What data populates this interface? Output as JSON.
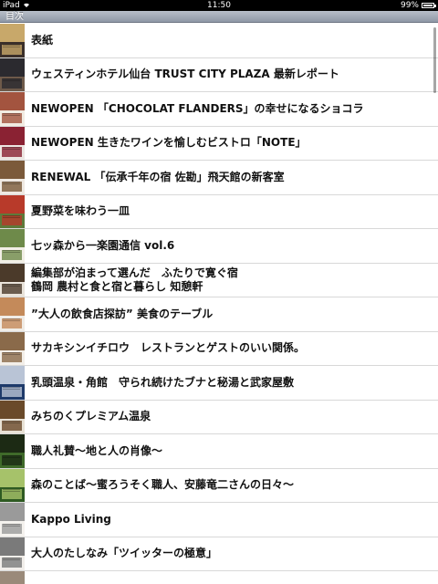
{
  "status": {
    "device": "iPad",
    "time": "11:50",
    "battery": "99%",
    "battery_level": 0.99
  },
  "header": {
    "title": "目次"
  },
  "items": [
    {
      "label": "表紙",
      "thumb": [
        "#3a2f2a",
        "#c8a86a"
      ]
    },
    {
      "label": "ウェスティンホテル仙台 TRUST CITY PLAZA 最新レポート",
      "thumb": [
        "#6e5a4a",
        "#2b2a2f"
      ]
    },
    {
      "label": "NEWOPEN 「CHOCOLAT FLANDERS」の幸せになるショコラ",
      "thumb": [
        "#f1ebe2",
        "#a3543f"
      ]
    },
    {
      "label": "NEWOPEN 生きたワインを愉しむビストロ「NOTE」",
      "thumb": [
        "#ece6e2",
        "#8a2233"
      ]
    },
    {
      "label": "RENEWAL 「伝承千年の宿 佐勘」飛天館の新客室",
      "thumb": [
        "#efe9e2",
        "#7b5a3a"
      ]
    },
    {
      "label": "夏野菜を味わう一皿",
      "thumb": [
        "#5d7a3a",
        "#b83a2a"
      ]
    },
    {
      "label": "七ッ森から一楽園通信 vol.6",
      "thumb": [
        "#f2efe6",
        "#6e8a4a"
      ]
    },
    {
      "label": "編集部が泊まって選んだ　ふたりで寛ぐ宿\n鶴岡 農村と食と宿と暮らし 知憩軒",
      "thumb": [
        "#e9e3da",
        "#4b3a2a"
      ]
    },
    {
      "label": "”大人の飲食店探訪” 美食のテーブル",
      "thumb": [
        "#f0ece6",
        "#c48a5a"
      ]
    },
    {
      "label": "サカキシンイチロウ　レストランとゲストのいい関係。",
      "thumb": [
        "#f3efe9",
        "#8a6a4a"
      ]
    },
    {
      "label": "乳頭温泉・角館　守られ続けたブナと秘湯と武家屋敷",
      "thumb": [
        "#1e3a6a",
        "#b9c4d6"
      ]
    },
    {
      "label": "みちのくプレミアム温泉",
      "thumb": [
        "#e8e2d6",
        "#6a4a2a"
      ]
    },
    {
      "label": "職人礼賛～地と人の肖像～",
      "thumb": [
        "#3f6a2a",
        "#1c2a14"
      ]
    },
    {
      "label": "森のことば～蜜ろうそく職人、安藤竜二さんの日々～",
      "thumb": [
        "#2e5a22",
        "#a6c26a"
      ]
    },
    {
      "label": "Kappo Living",
      "thumb": [
        "#f4f2ee",
        "#9a9a9a"
      ]
    },
    {
      "label": "大人のたしなみ「ツイッターの極意」",
      "thumb": [
        "#f1eeea",
        "#7a7a7a"
      ]
    },
    {
      "label": "…",
      "thumb": [
        "#e8e4de",
        "#9a8a7a"
      ]
    }
  ]
}
